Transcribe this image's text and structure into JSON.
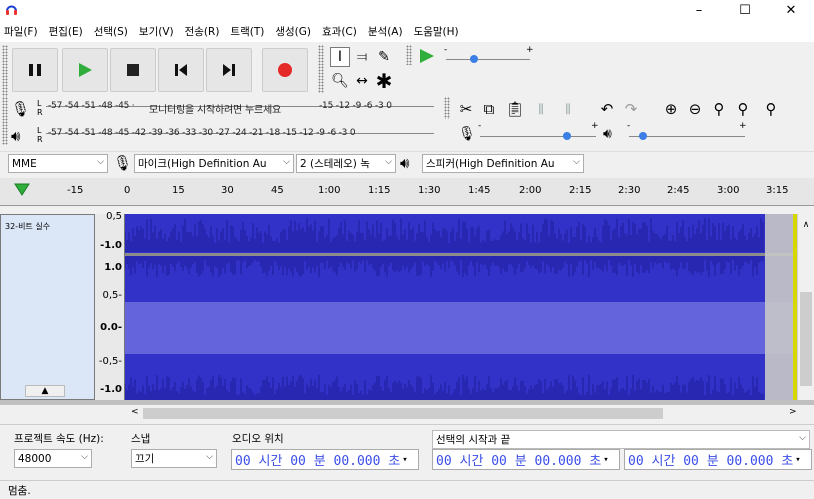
{
  "window": {
    "minimize": "–",
    "maximize": "☐",
    "close": "✕"
  },
  "menu": [
    "파일(F)",
    "편집(E)",
    "선택(S)",
    "보기(V)",
    "전송(R)",
    "트랙(T)",
    "생성(G)",
    "효과(C)",
    "분석(A)",
    "도움말(H)"
  ],
  "meters": {
    "record_scale": "-57 -54 -51 -48 -45 ·",
    "record_prompt": "모니터링을 시작하려면 누르세요",
    "record_scale_tail": "-15 -12 -9 -6 -3 0",
    "play_scale": "-57 -54 -51 -48 -45 -42 -39 -36 -33 -30 -27 -24 -21 -18 -15 -12 -9 -6 -3 0",
    "channel_l": "L",
    "channel_r": "R"
  },
  "play_speed": {
    "min": "-",
    "max": "+"
  },
  "device": {
    "host": "MME",
    "mic": "마이크(High Definition Au",
    "channels": "2 (스테레오) 녹",
    "speaker": "스피커(High Definition Au"
  },
  "ruler_ticks": [
    "-15",
    "0",
    "15",
    "30",
    "45",
    "1:00",
    "1:15",
    "1:30",
    "1:45",
    "2:00",
    "2:15",
    "2:30",
    "2:45",
    "3:00",
    "3:15"
  ],
  "track": {
    "info": "32-비트 실수",
    "scale_top": [
      "0,5",
      "-1.0"
    ],
    "scale_bottom": [
      "1.0",
      "0,5-",
      "0.0-",
      "-0,5-",
      "-1.0"
    ]
  },
  "selection": {
    "rate_label": "프로젝트 속도 (Hz):",
    "rate_value": "48000",
    "snap_label": "스냅",
    "snap_value": "끄기",
    "audio_pos_label": "오디오 위치",
    "audio_pos_value": "00 시간 00 분 00.000 초",
    "sel_label": "선택의 시작과 끝",
    "sel_start": "00 시간 00 분 00.000 초",
    "sel_end": "00 시간 00 분 00.000 초"
  },
  "status": "멈춤.",
  "colors": {
    "wave_dark": "#3232c8",
    "wave_light": "#6464dc",
    "accent_play": "#2fae3b",
    "record": "#e52828"
  }
}
